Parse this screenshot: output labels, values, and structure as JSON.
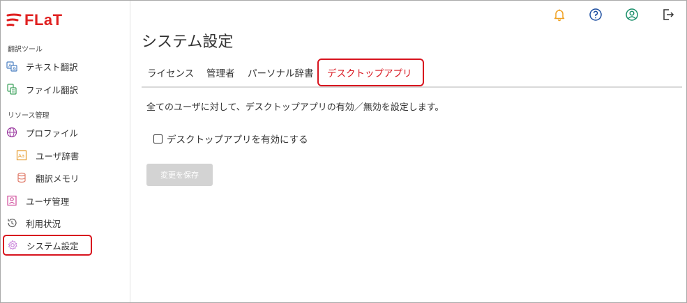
{
  "brand": {
    "logo_text": "FLaT",
    "color": "#e02020"
  },
  "accent_color": "#d8141e",
  "sidebar": {
    "sections": [
      {
        "label": "翻訳ツール"
      },
      {
        "label": "リソース管理"
      }
    ],
    "items": [
      {
        "label": "テキスト翻訳",
        "icon": "text-translate-icon"
      },
      {
        "label": "ファイル翻訳",
        "icon": "file-translate-icon"
      },
      {
        "label": "プロファイル",
        "icon": "globe-icon"
      },
      {
        "label": "ユーザ辞書",
        "icon": "dictionary-icon"
      },
      {
        "label": "翻訳メモリ",
        "icon": "database-icon"
      },
      {
        "label": "ユーザ管理",
        "icon": "user-card-icon"
      },
      {
        "label": "利用状況",
        "icon": "history-icon"
      },
      {
        "label": "システム設定",
        "icon": "gear-icon"
      }
    ]
  },
  "header": {
    "icons": [
      "bell-icon",
      "help-icon",
      "user-icon",
      "logout-icon"
    ]
  },
  "main": {
    "title": "システム設定",
    "tabs": [
      {
        "label": "ライセンス"
      },
      {
        "label": "管理者"
      },
      {
        "label": "パーソナル辞書"
      },
      {
        "label": "デスクトップアプリ",
        "active": true
      }
    ],
    "description": "全てのユーザに対して、デスクトップアプリの有効／無効を設定します。",
    "checkbox_label": "デスクトップアプリを有効にする",
    "checkbox_checked": false,
    "save_label": "変更を保存"
  }
}
